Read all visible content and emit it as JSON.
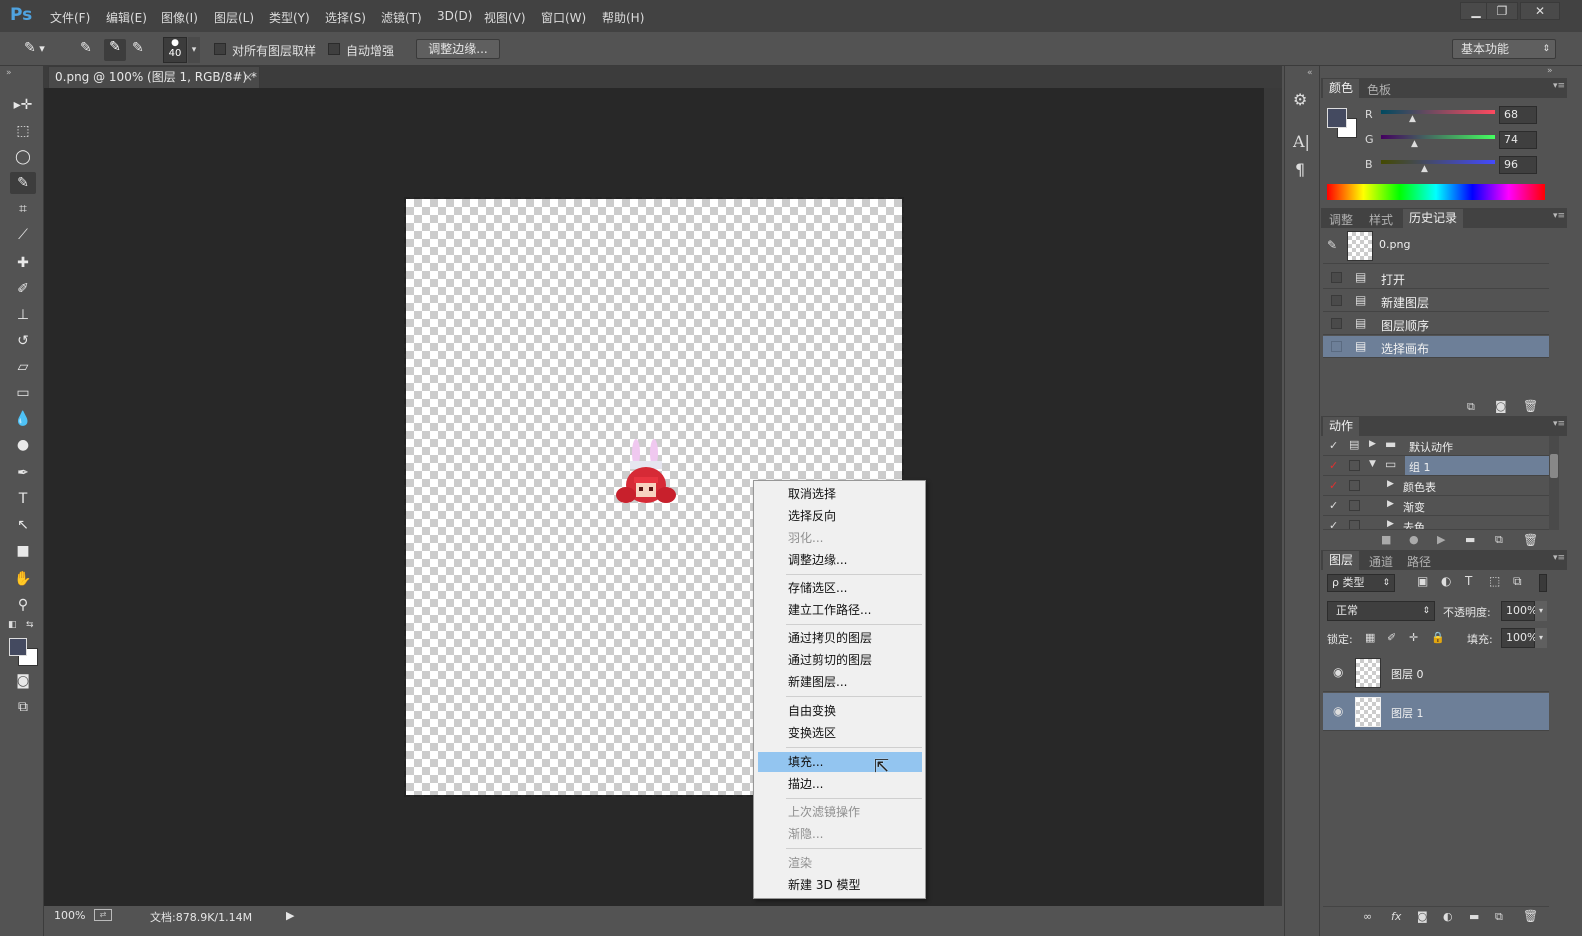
{
  "app": {
    "logo": "Ps"
  },
  "menubar": {
    "items": [
      "文件(F)",
      "编辑(E)",
      "图像(I)",
      "图层(L)",
      "类型(Y)",
      "选择(S)",
      "滤镜(T)",
      "3D(D)",
      "视图(V)",
      "窗口(W)",
      "帮助(H)"
    ],
    "window_buttons": [
      "▁",
      "❐",
      "✕"
    ]
  },
  "options": {
    "brush_size": "40",
    "sample_all_layers": "对所有图层取样",
    "auto_enhance": "自动增强",
    "refine_edge_button": "调整边缘...",
    "workspace": "基本功能"
  },
  "document": {
    "tab_title": "0.png @ 100% (图层 1, RGB/8#) *",
    "tab_close": "×"
  },
  "status": {
    "zoom": "100%",
    "doc_info": "文档:878.9K/1.14M"
  },
  "context_menu": {
    "items": [
      {
        "label": "取消选择",
        "disabled": false
      },
      {
        "label": "选择反向",
        "disabled": false
      },
      {
        "label": "羽化...",
        "disabled": true
      },
      {
        "label": "调整边缘...",
        "disabled": false
      },
      {
        "label": "存储选区...",
        "disabled": false
      },
      {
        "label": "建立工作路径...",
        "disabled": false
      },
      {
        "label": "通过拷贝的图层",
        "disabled": false
      },
      {
        "label": "通过剪切的图层",
        "disabled": false
      },
      {
        "label": "新建图层...",
        "disabled": false
      },
      {
        "label": "自由变换",
        "disabled": false
      },
      {
        "label": "变换选区",
        "disabled": false
      },
      {
        "label": "填充...",
        "disabled": false,
        "highlighted": true
      },
      {
        "label": "描边...",
        "disabled": false
      },
      {
        "label": "上次滤镜操作",
        "disabled": true
      },
      {
        "label": "渐隐...",
        "disabled": true
      },
      {
        "label": "渲染",
        "disabled": true
      },
      {
        "label": "新建 3D 模型",
        "disabled": false
      }
    ]
  },
  "color_panel": {
    "tabs": [
      "颜色",
      "色板"
    ],
    "r_label": "R",
    "g_label": "G",
    "b_label": "B",
    "r": "68",
    "g": "74",
    "b": "96",
    "foreground": "#444a60"
  },
  "history_panel": {
    "tabs": [
      "调整",
      "样式",
      "历史记录"
    ],
    "snapshot": "0.png",
    "items": [
      "打开",
      "新建图层",
      "图层顺序",
      "选择画布"
    ]
  },
  "actions_panel": {
    "tab": "动作",
    "items": [
      "默认动作",
      "组 1",
      "颜色表",
      "渐变",
      "去色"
    ]
  },
  "layers_panel": {
    "tabs": [
      "图层",
      "通道",
      "路径"
    ],
    "filter": "ρ 类型",
    "blend_mode": "正常",
    "opacity_label": "不透明度:",
    "opacity": "100%",
    "lock_label": "锁定:",
    "fill_label": "填充:",
    "fill": "100%",
    "layers": [
      "图层 0",
      "图层 1"
    ]
  }
}
